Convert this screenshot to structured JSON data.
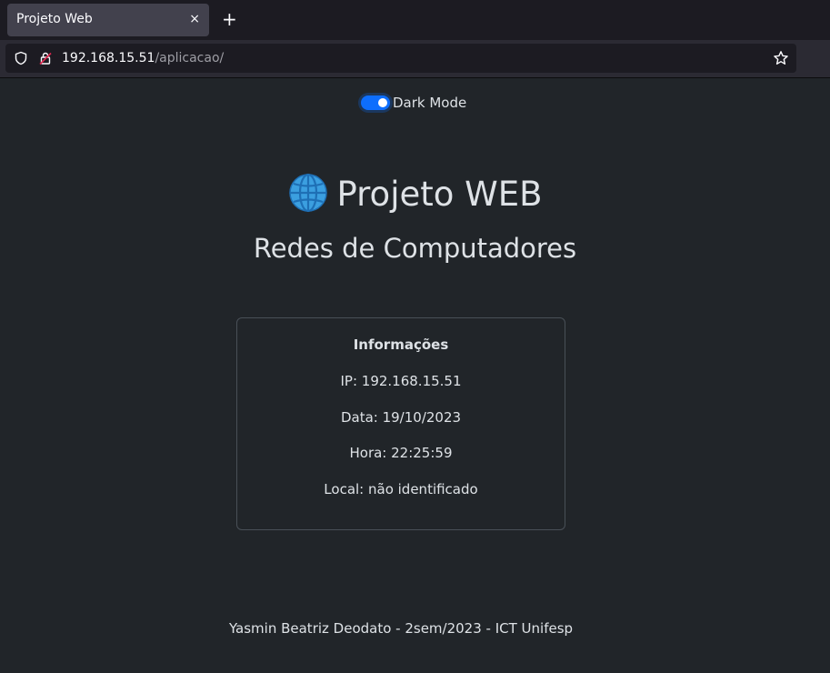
{
  "browser": {
    "tab_title": "Projeto Web",
    "tab_close": "×",
    "new_tab": "+",
    "url_host": "192.168.15.51",
    "url_path": "/aplicacao/"
  },
  "toggle": {
    "label": "Dark Mode",
    "checked": true,
    "color": "#0d6efd"
  },
  "header": {
    "title": "Projeto WEB",
    "title_icon": "globe-icon",
    "subtitle": "Redes de Computadores"
  },
  "info": {
    "title": "Informações",
    "ip": "IP: 192.168.15.51",
    "date": "Data: 19/10/2023",
    "time": "Hora: 22:25:59",
    "location": "Local: não identificado"
  },
  "footer": {
    "text": "Yasmin Beatriz Deodato - 2sem/2023 - ICT Unifesp"
  },
  "colors": {
    "background": "#212529",
    "text": "#dee2e6",
    "border": "#495057"
  }
}
